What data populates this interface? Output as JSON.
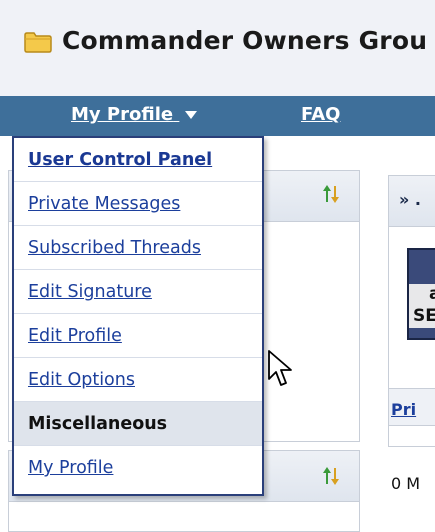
{
  "forum": {
    "title": "Commander Owners Grou"
  },
  "nav": {
    "my_profile": "My Profile",
    "faq": "FAQ"
  },
  "menu": {
    "items": [
      {
        "label": "User Control Panel",
        "bold": true
      },
      {
        "label": "Private Messages"
      },
      {
        "label": "Subscribed Threads"
      },
      {
        "label": "Edit Signature"
      },
      {
        "label": "Edit Profile"
      },
      {
        "label": "Edit Options"
      }
    ],
    "section": "Miscellaneous",
    "section_items": [
      {
        "label": "My Profile"
      }
    ]
  },
  "right_panel": {
    "heading": "» .",
    "image_text_1": "a",
    "image_text_2": "SE",
    "link_text": "Pri",
    "count_text": "0 M"
  },
  "colors": {
    "navbar": "#3e6f9a",
    "link": "#1c3f9c",
    "menu_border": "#2a3f7a"
  }
}
